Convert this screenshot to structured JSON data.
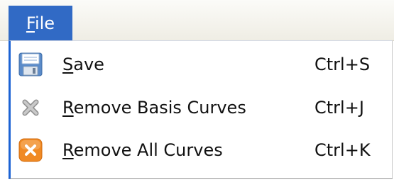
{
  "menubar": {
    "title_access_key": "F",
    "title_rest": "ile"
  },
  "menu": {
    "items": [
      {
        "icon": "save-icon",
        "label_access_key": "S",
        "label_rest": "ave",
        "shortcut": "Ctrl+S"
      },
      {
        "icon": "remove-basis-icon",
        "label_access_key": "R",
        "label_rest": "emove Basis Curves",
        "shortcut": "Ctrl+J"
      },
      {
        "icon": "remove-all-icon",
        "label_access_key": "R",
        "label_rest": "emove All Curves",
        "shortcut": "Ctrl+K"
      }
    ]
  },
  "colors": {
    "menubar_highlight": "#316ac5",
    "menu_border_accent": "#1c63d4",
    "remove_all_icon": "#f08a24",
    "remove_basis_icon": "#b7b7b7"
  }
}
